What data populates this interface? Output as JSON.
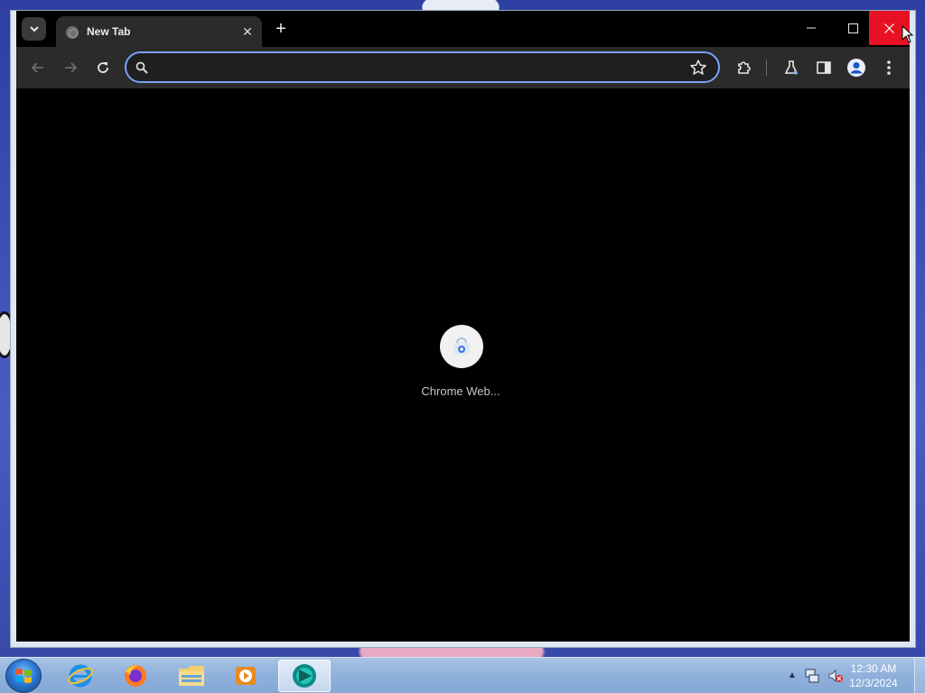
{
  "browser": {
    "tab": {
      "title": "New Tab",
      "close_glyph": "✕"
    },
    "new_tab_glyph": "+",
    "window_controls": {
      "minimize": "—",
      "maximize": "☐",
      "close": "✕"
    },
    "omnibox": {
      "value": "",
      "placeholder": ""
    },
    "content": {
      "shortcut": {
        "label": "Chrome Web..."
      }
    },
    "colors": {
      "accent_focus": "#7aa2f7",
      "close_hover": "#e81123",
      "toolbar": "#2b2b2b",
      "page_bg": "#000000"
    }
  },
  "taskbar": {
    "apps": [
      {
        "name": "internet-explorer-icon"
      },
      {
        "name": "firefox-icon"
      },
      {
        "name": "file-explorer-icon"
      },
      {
        "name": "media-player-icon"
      },
      {
        "name": "chrome-icon",
        "active": true
      }
    ],
    "tray": {
      "time": "12:30 AM",
      "date": "12/3/2024"
    }
  }
}
